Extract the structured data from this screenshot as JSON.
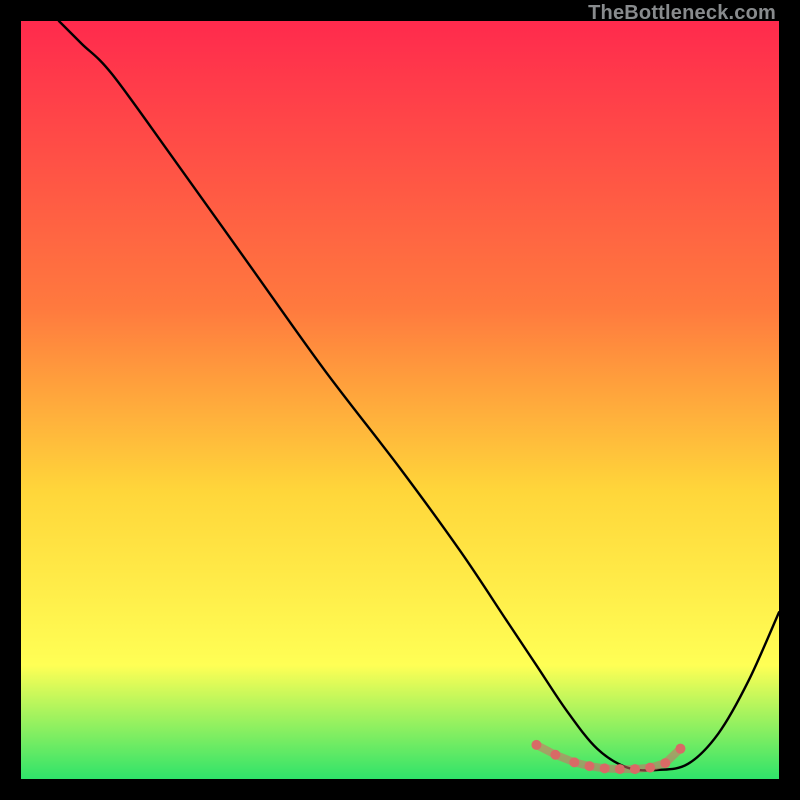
{
  "watermark": "TheBottleneck.com",
  "chart_data": {
    "type": "line",
    "title": "",
    "xlabel": "",
    "ylabel": "",
    "xlim": [
      0,
      100
    ],
    "ylim": [
      0,
      100
    ],
    "grid": false,
    "legend": false,
    "background_gradient": {
      "top_color": "#ff2a4d",
      "mid_color_1": "#ff7a3e",
      "mid_color_2": "#ffd63a",
      "mid_color_3": "#ffff55",
      "bottom_color": "#2fe36a"
    },
    "series": [
      {
        "name": "bottleneck_curve",
        "color": "#000000",
        "x": [
          5,
          8,
          12,
          20,
          30,
          40,
          50,
          58,
          64,
          68,
          72,
          76,
          80,
          84,
          88,
          92,
          96,
          100
        ],
        "y": [
          100,
          97,
          93,
          82,
          68,
          54,
          41,
          30,
          21,
          15,
          9,
          4,
          1.5,
          1.2,
          2,
          6,
          13,
          22
        ]
      }
    ],
    "flat_region_markers": {
      "color": "#d86a66",
      "radius": 5,
      "x": [
        68,
        70.5,
        73,
        75,
        77,
        79,
        81,
        83,
        85,
        87
      ],
      "y": [
        4.5,
        3.2,
        2.2,
        1.7,
        1.4,
        1.3,
        1.3,
        1.5,
        2.1,
        4.0
      ]
    }
  }
}
